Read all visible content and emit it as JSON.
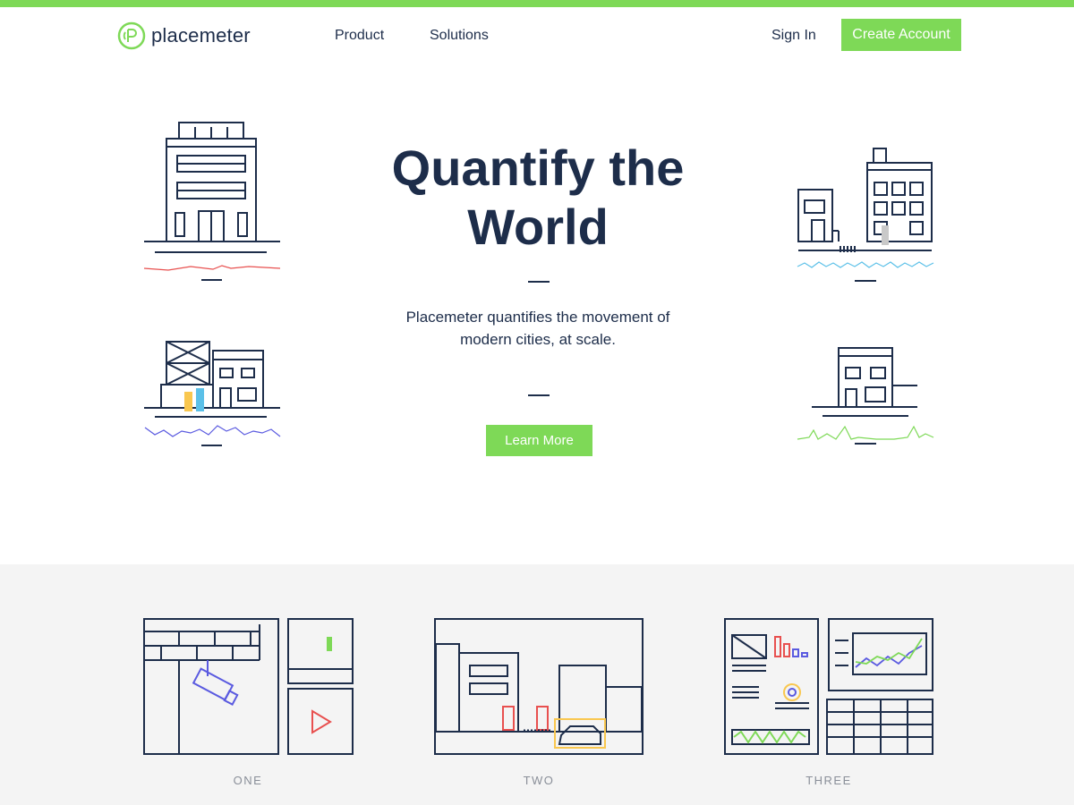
{
  "brand": {
    "name": "placemeter",
    "accent": "#7ed957",
    "navy": "#1d2d4a"
  },
  "nav": {
    "items": [
      {
        "label": "Product"
      },
      {
        "label": "Solutions"
      }
    ],
    "sign_in": "Sign In",
    "create_account": "Create Account"
  },
  "hero": {
    "title_line1": "Quantify the",
    "title_line2": "World",
    "description": "Placemeter quantifies the movement of modern cities, at scale.",
    "cta": "Learn More"
  },
  "illustrations": {
    "building_1": {
      "icon": "building-icon",
      "graph_color": "#e8504f"
    },
    "building_2": {
      "icon": "building-icon",
      "graph_color": "#5bc0e8"
    },
    "building_3": {
      "icon": "construction-icon",
      "graph_color": "#5a5ae0"
    },
    "building_4": {
      "icon": "building-icon",
      "graph_color": "#7ed957"
    }
  },
  "steps": [
    {
      "label": "ONE",
      "icon": "camera-icon"
    },
    {
      "label": "TWO",
      "icon": "street-detection-icon"
    },
    {
      "label": "THREE",
      "icon": "dashboard-icon"
    }
  ]
}
